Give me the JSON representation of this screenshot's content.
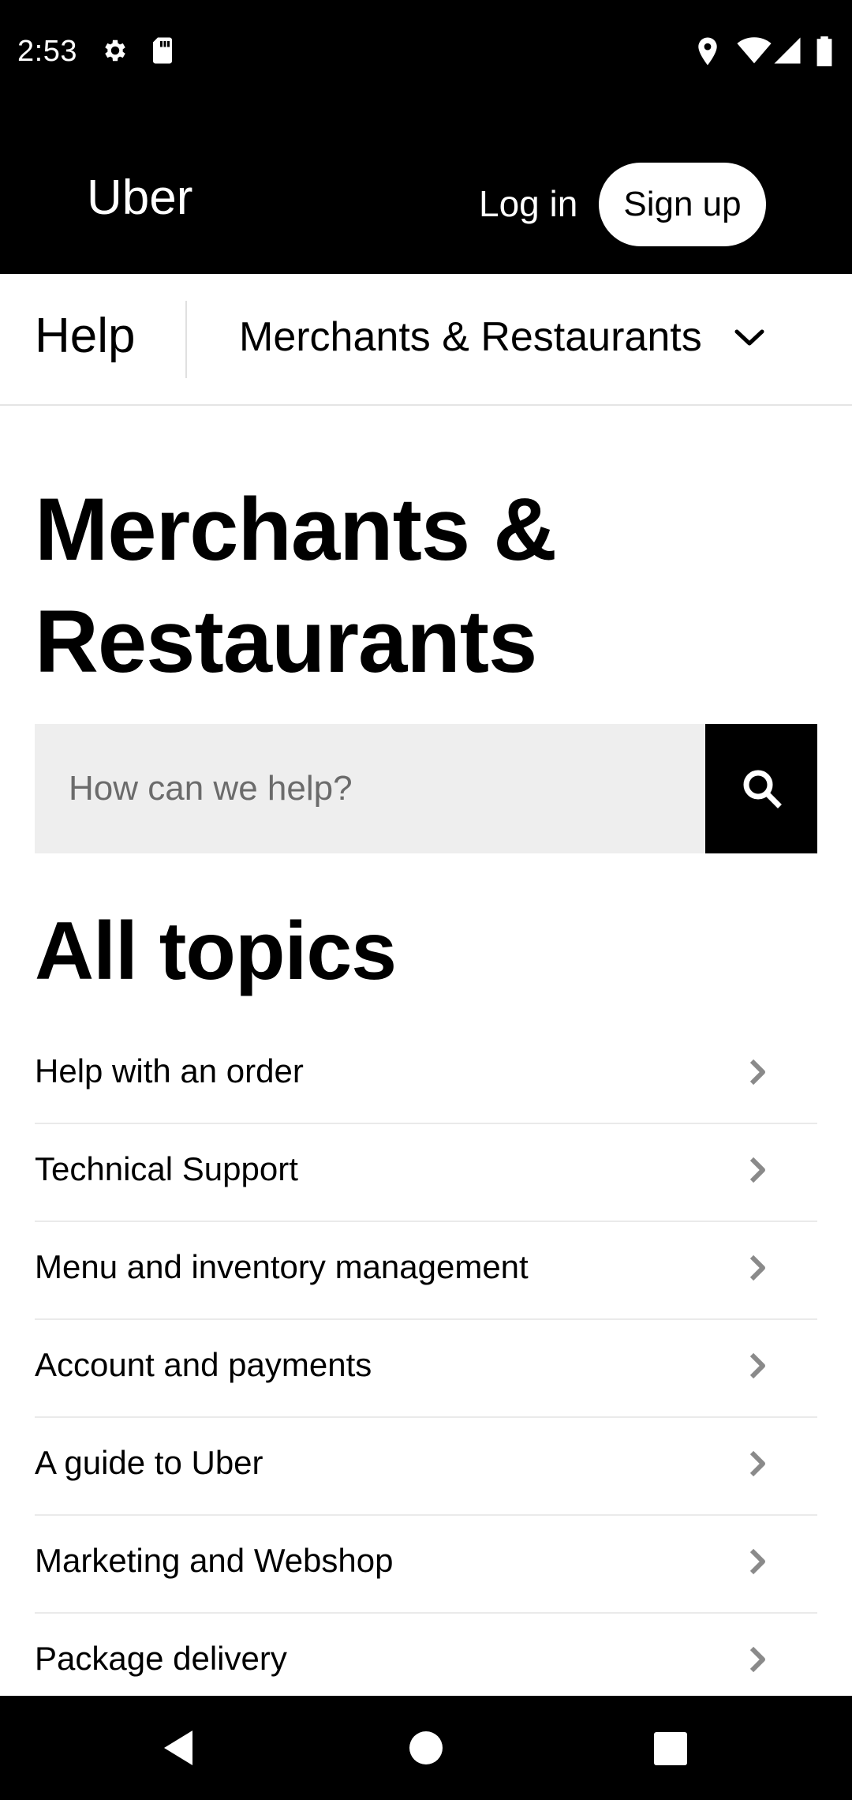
{
  "status_bar": {
    "time": "2:53",
    "icons": [
      "settings-icon",
      "sd-card-icon",
      "location-icon",
      "wifi-icon",
      "signal-icon",
      "battery-icon"
    ]
  },
  "header": {
    "brand": "Uber",
    "login_label": "Log in",
    "signup_label": "Sign up"
  },
  "subnav": {
    "help_label": "Help",
    "category_label": "Merchants & Restaurants",
    "dropdown_icon": "chevron-down-icon"
  },
  "page": {
    "title_line1": "Merchants &",
    "title_line2": "Restaurants"
  },
  "search": {
    "placeholder": "How can we help?",
    "value": "",
    "icon": "search-icon"
  },
  "topics": {
    "heading": "All topics",
    "items": [
      {
        "label": "Help with an order"
      },
      {
        "label": "Technical Support"
      },
      {
        "label": "Menu and inventory management"
      },
      {
        "label": "Account and payments"
      },
      {
        "label": "A guide to Uber"
      },
      {
        "label": "Marketing and Webshop"
      },
      {
        "label": "Package delivery"
      }
    ]
  },
  "nav_bar": {
    "buttons": [
      "back-icon",
      "home-icon",
      "recents-icon"
    ]
  },
  "colors": {
    "header_bg": "#000000",
    "search_bg": "#eeeeee",
    "chevron": "#8a8a8a"
  }
}
